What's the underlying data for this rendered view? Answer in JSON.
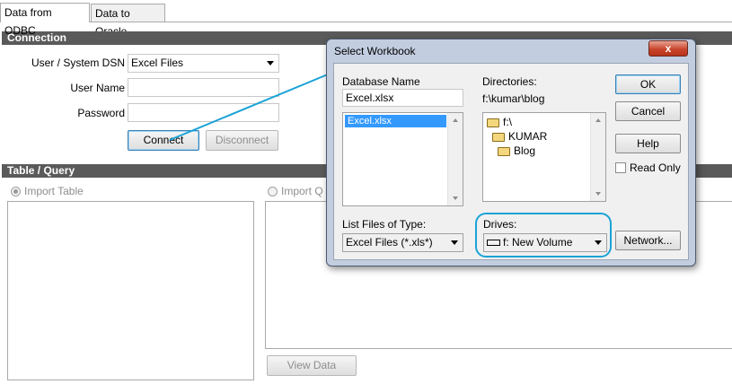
{
  "tabs": [
    {
      "label": "Data from ODBC",
      "active": true
    },
    {
      "label": "Data to Oracle",
      "active": false
    }
  ],
  "connection": {
    "section_title": "Connection",
    "dsn_label": "User / System DSN",
    "dsn_value": "Excel Files",
    "username_label": "User Name",
    "username_value": "",
    "password_label": "Password",
    "password_value": "",
    "connect_label": "Connect",
    "disconnect_label": "Disconnect"
  },
  "table_query": {
    "section_title": "Table / Query",
    "import_table_label": "Import Table",
    "import_query_label": "Import Q",
    "view_data_label": "View Data"
  },
  "dialog": {
    "title": "Select Workbook",
    "close_glyph": "x",
    "database_name_label": "Database Name",
    "database_name_value": "Excel.xlsx",
    "files": [
      "Excel.xlsx"
    ],
    "directories_label": "Directories:",
    "current_dir": "f:\\kumar\\blog",
    "dirs": [
      "f:\\",
      "KUMAR",
      "Blog"
    ],
    "list_type_label": "List Files of Type:",
    "list_type_value": "Excel Files (*.xls*)",
    "drives_label": "Drives:",
    "drives_value": "f: New Volume",
    "ok_label": "OK",
    "cancel_label": "Cancel",
    "help_label": "Help",
    "read_only_label": "Read Only",
    "network_label": "Network..."
  },
  "colors": {
    "annotation": "#1aa3d6",
    "selection": "#3399ff",
    "section_bar": "#5a5a5a"
  }
}
